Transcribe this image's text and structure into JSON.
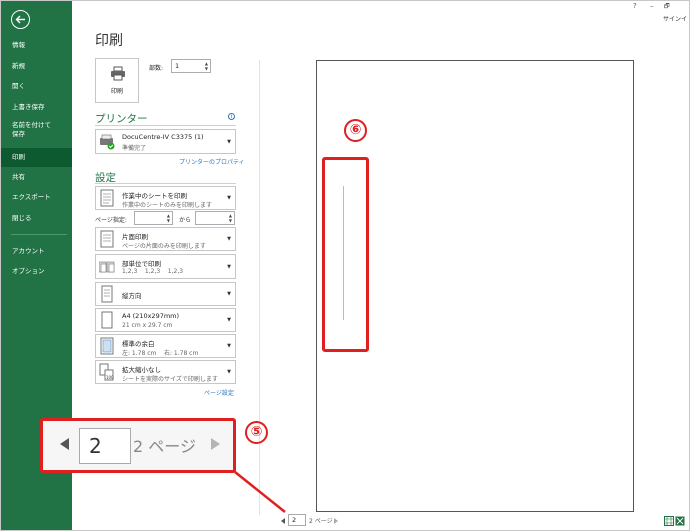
{
  "window": {
    "help": "?",
    "minimize": "–",
    "restore": "🗗",
    "signin": "サインイ"
  },
  "sidebar": {
    "items": [
      {
        "label": "情報"
      },
      {
        "label": "新規"
      },
      {
        "label": "開く"
      },
      {
        "label": "上書き保存"
      },
      {
        "label": "名前を付けて\n保存"
      },
      {
        "label": "印刷"
      },
      {
        "label": "共有"
      },
      {
        "label": "エクスポート"
      },
      {
        "label": "閉じる"
      },
      {
        "label": "アカウント"
      },
      {
        "label": "オプション"
      }
    ]
  },
  "print": {
    "title": "印刷",
    "button_label": "印刷",
    "copies_label": "部数:",
    "copies_value": "1"
  },
  "printer": {
    "heading": "プリンター",
    "name": "DocuCentre-IV C3375 (1)",
    "status": "準備完了",
    "properties_link": "プリンターのプロパティ"
  },
  "settings": {
    "heading": "設定",
    "what": {
      "t1": "作業中のシートを印刷",
      "t2": "作業中のシートのみを印刷します"
    },
    "page_range_label": "ページ指定:",
    "to_label": "から",
    "sides": {
      "t1": "片面印刷",
      "t2": "ページの片面のみを印刷します"
    },
    "collate": {
      "t1": "部単位で印刷",
      "t2": "1,2,3    1,2,3    1,2,3"
    },
    "orientation": {
      "t1": "縦方向"
    },
    "paper": {
      "t1": "A4 (210x297mm)",
      "t2": "21 cm x 29.7 cm"
    },
    "margins": {
      "t1": "標準の余白",
      "t2": "左: 1.78 cm    右: 1.78 cm"
    },
    "scaling": {
      "t1": "拡大縮小なし",
      "t2": "シートを実際のサイズで印刷します"
    },
    "page_setup_link": "ページ設定"
  },
  "preview_nav": {
    "page_value": "2",
    "total_label": "2 ページ"
  },
  "callouts": {
    "five": "⑤",
    "six": "⑥"
  },
  "colors": {
    "accent": "#217346",
    "callout": "#e02020"
  }
}
